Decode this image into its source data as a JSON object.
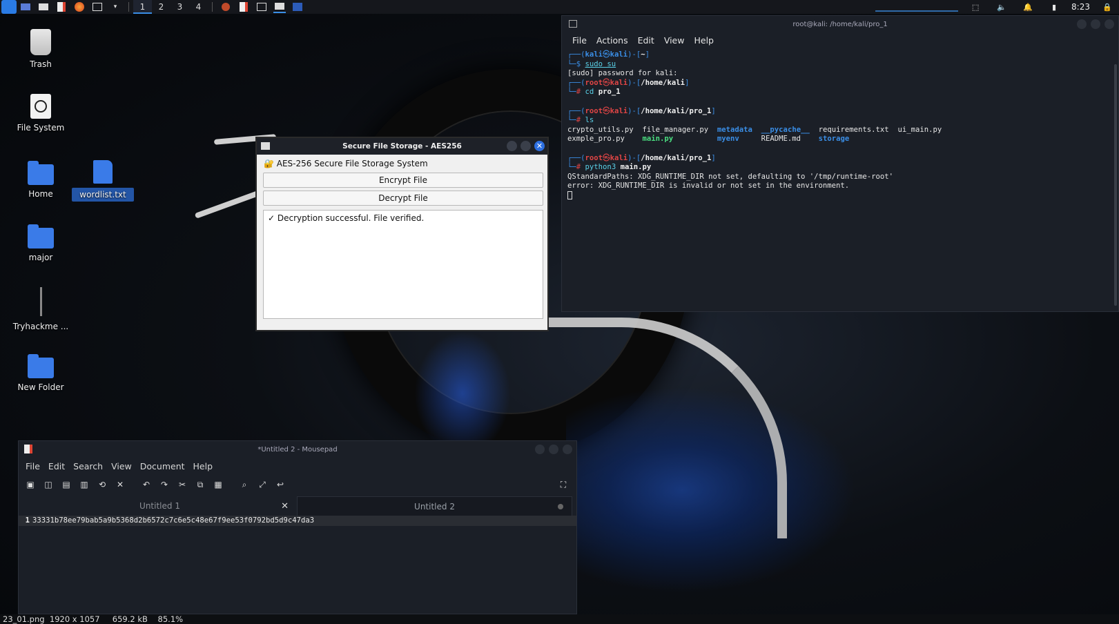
{
  "top_panel": {
    "workspaces": [
      "1",
      "2",
      "3",
      "4"
    ],
    "clock": "8:23"
  },
  "desktop": {
    "icons": [
      {
        "label": "Trash"
      },
      {
        "label": "File System"
      },
      {
        "label": "Home"
      },
      {
        "label": "wordlist.txt"
      },
      {
        "label": "major"
      },
      {
        "label": "Tryhackme ..."
      },
      {
        "label": "New Folder"
      }
    ]
  },
  "terminal": {
    "title": "root@kali: /home/kali/pro_1",
    "menu": [
      "File",
      "Actions",
      "Edit",
      "View",
      "Help"
    ],
    "lines": {
      "p1_user": "kali",
      "p1_host": "kali",
      "p1_dir": "~",
      "cmd1": "sudo su",
      "out1": "[sudo] password for kali:",
      "p2_user": "root",
      "p2_host": "kali",
      "p2_dir": "/home/kali",
      "cmd2_a": "cd",
      "cmd2_b": "pro_1",
      "p3_dir": "/home/kali/pro_1",
      "cmd3": "ls",
      "ls_row1": [
        "crypto_utils.py",
        "file_manager.py",
        "metadata",
        "__pycache__",
        "requirements.txt",
        "ui_main.py"
      ],
      "ls_row2": [
        "exmple_pro.py",
        "main.py",
        "myenv",
        "README.md",
        "storage"
      ],
      "p4_dir": "/home/kali/pro_1",
      "cmd4_a": "python3",
      "cmd4_b": "main.py",
      "out4_1": "QStandardPaths: XDG_RUNTIME_DIR not set, defaulting to '/tmp/runtime-root'",
      "out4_2": "error: XDG_RUNTIME_DIR is invalid or not set in the environment."
    }
  },
  "aes_dialog": {
    "title": "Secure File Storage - AES256",
    "header": "🔐 AES-256 Secure File Storage System",
    "encrypt_label": "Encrypt File",
    "decrypt_label": "Decrypt File",
    "output": "✓ Decryption successful. File verified."
  },
  "mousepad": {
    "title": "*Untitled 2 - Mousepad",
    "menu": [
      "File",
      "Edit",
      "Search",
      "View",
      "Document",
      "Help"
    ],
    "tabs": [
      "Untitled 1",
      "Untitled 2"
    ],
    "line_number": "1",
    "line_text": "33331b78ee79bab5a9b5368d2b6572c7c6e5c48e67f9ee53f0792bd5d9c47da3"
  },
  "status_bar": {
    "text": "23_01.png  1920 x 1057     659.2 kB    85.1%"
  }
}
